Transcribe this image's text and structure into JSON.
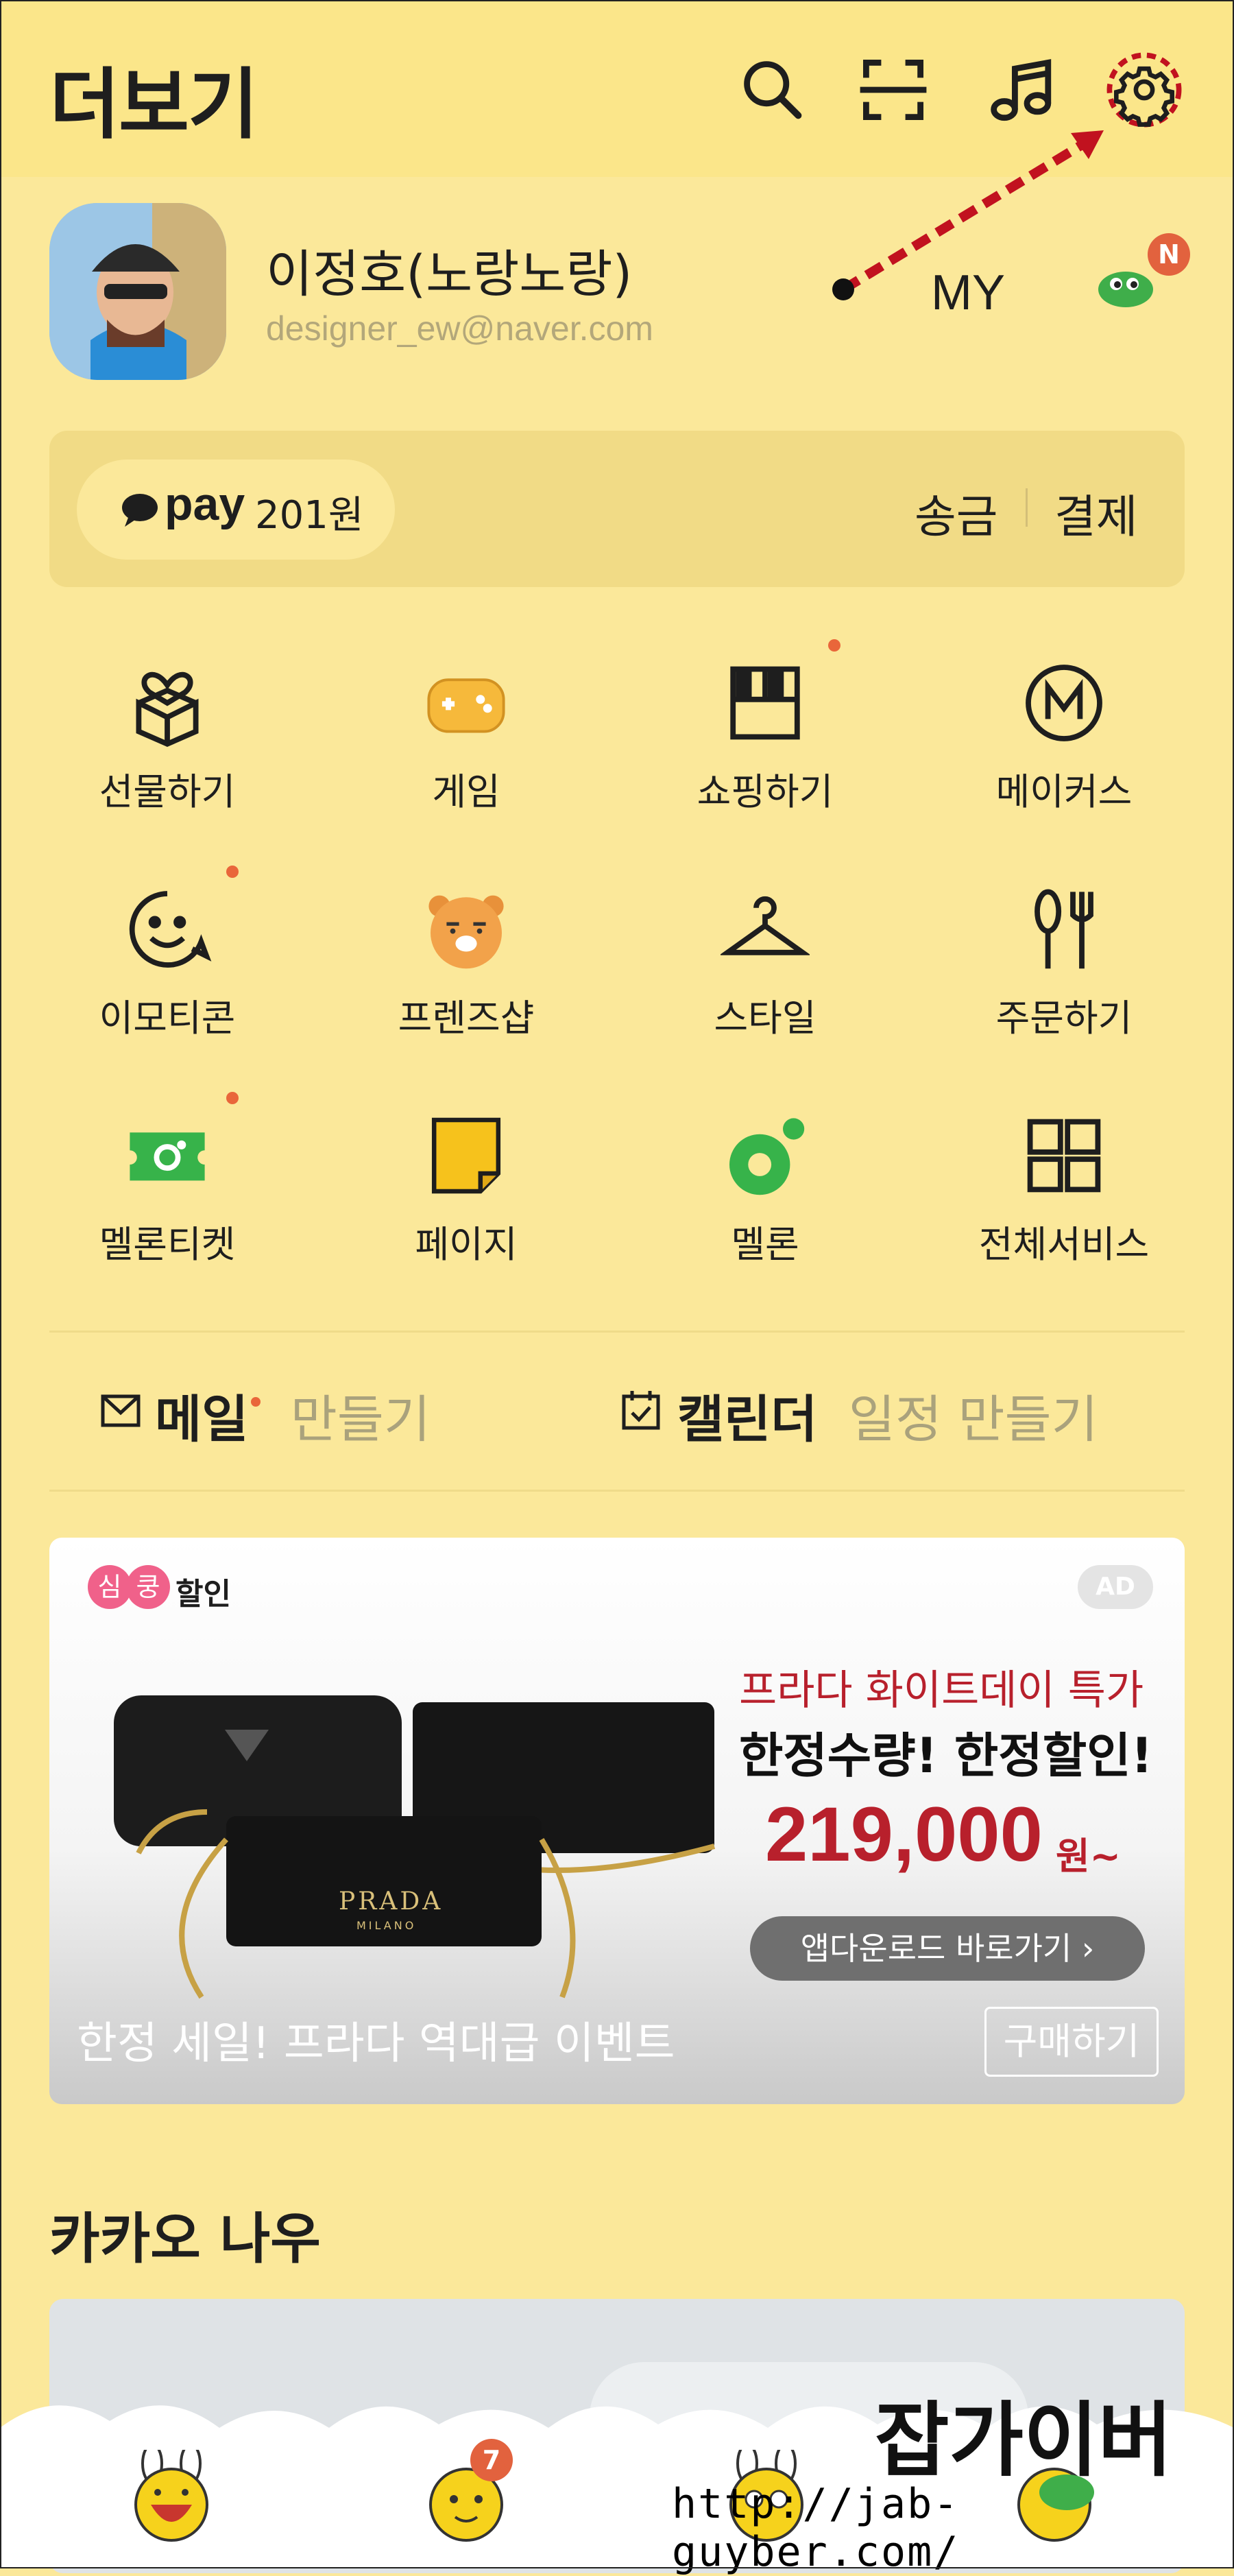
{
  "header": {
    "title": "더보기",
    "icons": [
      "search-icon",
      "scan-icon",
      "music-icon",
      "gear-icon"
    ]
  },
  "profile": {
    "name": "이정호(노랑노랑)",
    "email": "designer_ew@naver.com",
    "my_label": "MY",
    "badge": "N"
  },
  "pay": {
    "logo": "pay",
    "amount": "201원",
    "send_label": "송금",
    "pay_label": "결제"
  },
  "services": [
    {
      "label": "선물하기",
      "icon": "gift-icon",
      "dot": false
    },
    {
      "label": "게임",
      "icon": "gamepad-icon",
      "dot": false
    },
    {
      "label": "쇼핑하기",
      "icon": "shop-icon",
      "dot": true
    },
    {
      "label": "메이커스",
      "icon": "makers-icon",
      "dot": false
    },
    {
      "label": "이모티콘",
      "icon": "smiley-icon",
      "dot": true
    },
    {
      "label": "프렌즈샵",
      "icon": "ryan-icon",
      "dot": false
    },
    {
      "label": "스타일",
      "icon": "hanger-icon",
      "dot": false
    },
    {
      "label": "주문하기",
      "icon": "fork-knife-icon",
      "dot": false
    },
    {
      "label": "멜론티켓",
      "icon": "ticket-icon",
      "dot": true
    },
    {
      "label": "페이지",
      "icon": "page-icon",
      "dot": false
    },
    {
      "label": "멜론",
      "icon": "melon-icon",
      "dot": false
    },
    {
      "label": "전체서비스",
      "icon": "grid-icon",
      "dot": false
    }
  ],
  "quick": {
    "mail_label": "메일",
    "mail_sub": "만들기",
    "calendar_label": "캘린더",
    "calendar_sub": "일정 만들기"
  },
  "ad": {
    "brand": "심쿵할인",
    "brand_chars": [
      "심",
      "쿵",
      "할인"
    ],
    "ad_badge": "AD",
    "headline1": "프라다 화이트데이 특가",
    "headline2": "한정수량! 한정할인!",
    "price": "219,000",
    "price_unit": "원~",
    "app_button": "앱다운로드 바로가기 ›",
    "caption": "한정 세일! 프라다 역대급 이벤트",
    "buy_button": "구매하기",
    "bag_logo": "PRADA",
    "bag_sub": "MILANO"
  },
  "kakao_now": {
    "title": "카카오 나우"
  },
  "bottom_nav": {
    "badge": "7"
  },
  "watermark": {
    "text": "잡가이버",
    "url": "http://jab-guyber.com/"
  }
}
